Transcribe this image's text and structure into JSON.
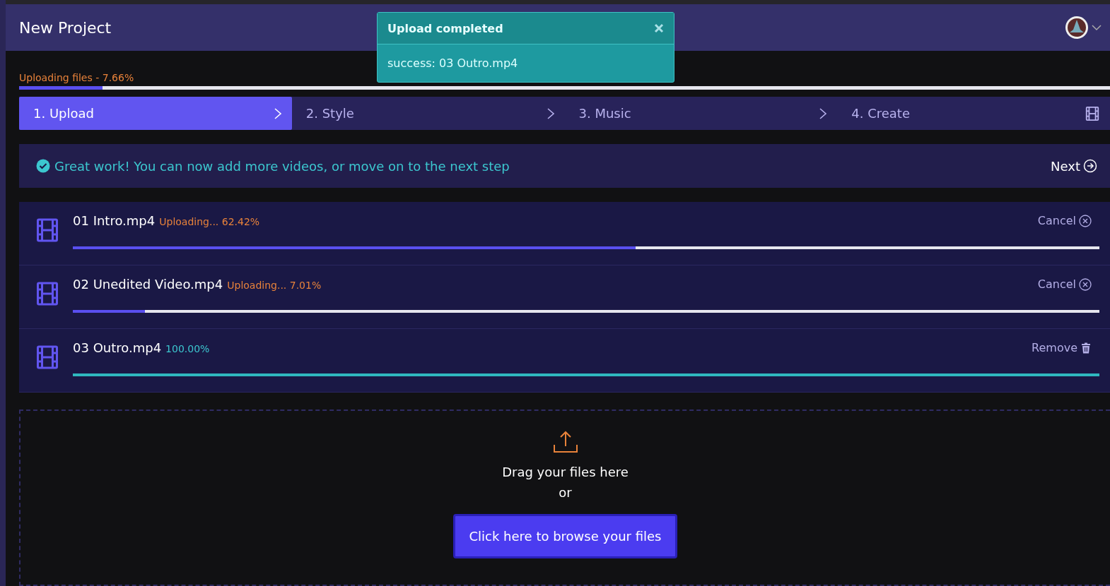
{
  "header": {
    "title": "New Project"
  },
  "toast": {
    "title": "Upload completed",
    "message": "success: 03 Outro.mp4"
  },
  "overall": {
    "label": "Uploading files - 7.66%",
    "level": 0.0766
  },
  "steps": [
    {
      "label": "1. Upload",
      "selected": true
    },
    {
      "label": "2. Style",
      "selected": false
    },
    {
      "label": "3. Music",
      "selected": false
    },
    {
      "label": "4. Create",
      "selected": false
    }
  ],
  "banner": {
    "message": "Great work! You can now add more videos, or move on to the next step",
    "next": "Next"
  },
  "files": [
    {
      "name": "01 Intro.mp4",
      "status": "Uploading... 62.42%",
      "kind": "uploading",
      "level": 0.5484,
      "action": "Cancel"
    },
    {
      "name": "02 Unedited Video.mp4",
      "status": "Uploading... 7.01%",
      "kind": "uploading",
      "level": 0.0701,
      "action": "Cancel"
    },
    {
      "name": "03 Outro.mp4",
      "status": "100.00%",
      "kind": "done",
      "level": 1,
      "action": "Remove"
    }
  ],
  "dropzone": {
    "prompt": "Drag your files here",
    "or": "or",
    "button": "Click here to browse your files"
  }
}
